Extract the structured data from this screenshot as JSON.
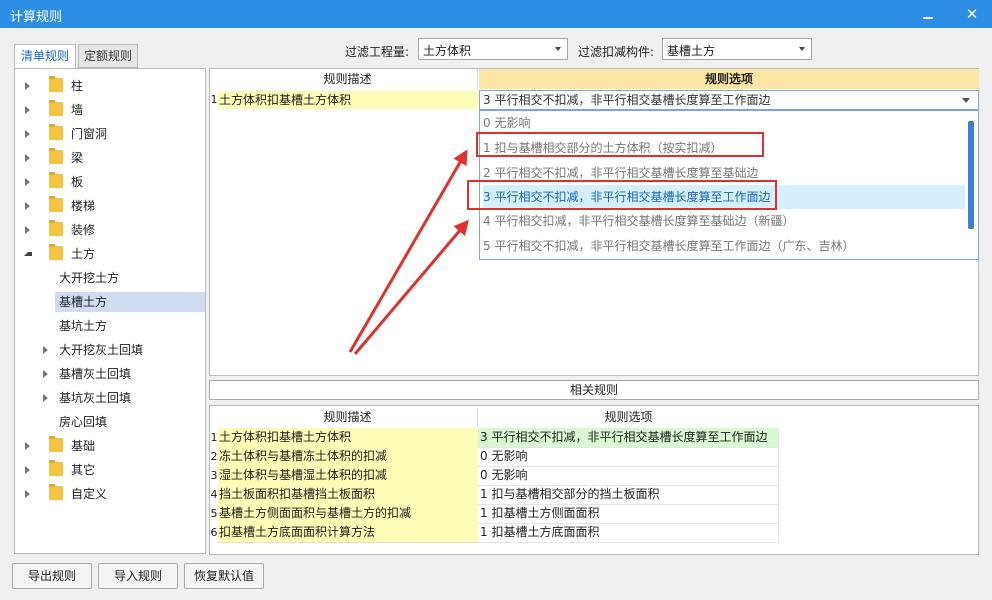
{
  "window": {
    "title": "计算规则",
    "minimize": "",
    "close": "✕"
  },
  "tabs": [
    {
      "label": "清单规则",
      "active": true
    },
    {
      "label": "定额规则",
      "active": false
    }
  ],
  "filters": {
    "quantity_label": "过滤工程量:",
    "quantity_value": "土方体积",
    "component_label": "过滤扣减构件:",
    "component_value": "基槽土方"
  },
  "tree": [
    {
      "label": "柱",
      "type": "folder",
      "expandable": true
    },
    {
      "label": "墙",
      "type": "folder",
      "expandable": true
    },
    {
      "label": "门窗洞",
      "type": "folder",
      "expandable": true
    },
    {
      "label": "梁",
      "type": "folder",
      "expandable": true
    },
    {
      "label": "板",
      "type": "folder",
      "expandable": true
    },
    {
      "label": "楼梯",
      "type": "folder",
      "expandable": true
    },
    {
      "label": "装修",
      "type": "folder",
      "expandable": true
    },
    {
      "label": "土方",
      "type": "folder",
      "expanded": true
    },
    {
      "label": "大开挖土方",
      "type": "child"
    },
    {
      "label": "基槽土方",
      "type": "child",
      "selected": true
    },
    {
      "label": "基坑土方",
      "type": "child"
    },
    {
      "label": "大开挖灰土回填",
      "type": "child",
      "expandable": true
    },
    {
      "label": "基槽灰土回填",
      "type": "child",
      "expandable": true
    },
    {
      "label": "基坑灰土回填",
      "type": "child",
      "expandable": true
    },
    {
      "label": "房心回填",
      "type": "child"
    },
    {
      "label": "基础",
      "type": "folder",
      "expandable": true
    },
    {
      "label": "其它",
      "type": "folder",
      "expandable": true
    },
    {
      "label": "自定义",
      "type": "folder",
      "expandable": true
    }
  ],
  "rules_table": {
    "col_desc": "规则描述",
    "col_option": "规则选项",
    "row": {
      "num": "1",
      "desc": "土方体积扣基槽土方体积",
      "value": "3  平行相交不扣减，非平行相交基槽长度算至工作面边"
    },
    "options": [
      "0  无影响",
      "1  扣与基槽相交部分的土方体积（按实扣减）",
      "2  平行相交不扣减，非平行相交基槽长度算至基础边",
      "3  平行相交不扣减，非平行相交基槽长度算至工作面边",
      "4  平行相交扣减，非平行相交基槽长度算至基础边（新疆）",
      "5  平行相交不扣减，非平行相交基槽长度算至工作面边（广东、吉林）"
    ],
    "selected_index": 3
  },
  "related": {
    "title": "相关规则",
    "col_desc": "规则描述",
    "col_option": "规则选项",
    "rows": [
      {
        "num": "1",
        "desc": "土方体积扣基槽土方体积",
        "value": "3   平行相交不扣减，非平行相交基槽长度算至工作面边"
      },
      {
        "num": "2",
        "desc": "冻土体积与基槽冻土体积的扣减",
        "value": "0   无影响"
      },
      {
        "num": "3",
        "desc": "湿土体积与基槽湿土体积的扣减",
        "value": "0   无影响"
      },
      {
        "num": "4",
        "desc": "挡土板面积扣基槽挡土板面积",
        "value": "1   扣与基槽相交部分的挡土板面积"
      },
      {
        "num": "5",
        "desc": "基槽土方侧面面积与基槽土方的扣减",
        "value": "1  扣基槽土方侧面面积"
      },
      {
        "num": "6",
        "desc": "扣基槽土方底面面积计算方法",
        "value": "1  扣基槽土方底面面积"
      }
    ]
  },
  "buttons": {
    "export": "导出规则",
    "import": "导入规则",
    "reset": "恢复默认值"
  },
  "colors": {
    "titlebar": "#2b8de4",
    "highlight": "#d5f0fc",
    "annotation": "#e03030",
    "yellow_cell": "#fdfcb6",
    "green_cell": "#d9f7d0"
  }
}
